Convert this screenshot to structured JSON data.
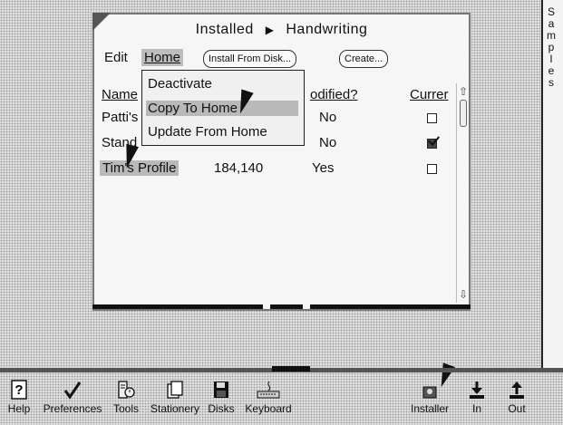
{
  "window": {
    "breadcrumb": [
      "Installed",
      "Handwriting"
    ],
    "breadcrumb_separator": "▶",
    "menu": {
      "edit": "Edit",
      "home": "Home",
      "install_from_disk": "Install From Disk...",
      "create": "Create..."
    },
    "table": {
      "headers": {
        "name": "Name",
        "modified": "Modified?",
        "current": "Current"
      },
      "header_visible": {
        "name": "Name",
        "modified": "odified?",
        "current": "Currer"
      },
      "rows": [
        {
          "name": "Patti's",
          "size": "",
          "modified": "No",
          "current": false
        },
        {
          "name": "Stand",
          "size": "",
          "modified": "No",
          "current": true
        },
        {
          "name": "Tim's Profile",
          "size": "184,140",
          "modified": "Yes",
          "current": false
        }
      ]
    },
    "dropdown": [
      {
        "label": "Deactivate",
        "highlighted": false
      },
      {
        "label": "Copy To Home",
        "highlighted": true
      },
      {
        "label": "Update From Home",
        "highlighted": false
      }
    ]
  },
  "edge_tab": {
    "label": "Samples"
  },
  "dock": {
    "items": [
      {
        "label": "Help",
        "icon": "help-icon"
      },
      {
        "label": "Preferences",
        "icon": "checkmark-icon"
      },
      {
        "label": "Tools",
        "icon": "tools-icon"
      },
      {
        "label": "Stationery",
        "icon": "stationery-icon"
      },
      {
        "label": "Disks",
        "icon": "disk-icon"
      },
      {
        "label": "Keyboard",
        "icon": "keyboard-icon"
      },
      {
        "label": "Installer",
        "icon": "installer-icon"
      },
      {
        "label": "In",
        "icon": "inbox-arrow-icon"
      },
      {
        "label": "Out",
        "icon": "outbox-arrow-icon"
      }
    ]
  },
  "colors": {
    "desktop": "#d2d2d2",
    "window": "#f6f6f6",
    "highlight": "#b9b9b9",
    "ink": "#111111"
  }
}
